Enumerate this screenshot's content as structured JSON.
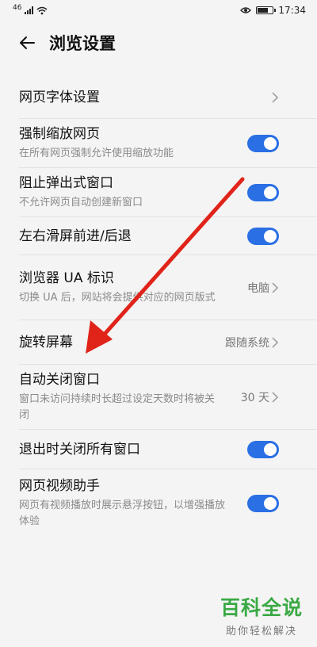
{
  "statusbar": {
    "signal": "46",
    "time": "17:34"
  },
  "header": {
    "title": "浏览设置"
  },
  "settings": [
    {
      "label": "网页字体设置",
      "desc": "",
      "control": "chevron",
      "value": ""
    },
    {
      "label": "强制缩放网页",
      "desc": "在所有网页强制允许使用缩放功能",
      "control": "toggle",
      "on": true
    },
    {
      "label": "阻止弹出式窗口",
      "desc": "不允许网页自动创建新窗口",
      "control": "toggle",
      "on": true
    },
    {
      "label": "左右滑屏前进/后退",
      "desc": "",
      "control": "toggle",
      "on": true
    },
    {
      "label": "浏览器 UA 标识",
      "desc": "切换 UA 后，网站将会提供对应的网页版式",
      "control": "chevron",
      "value": "电脑"
    },
    {
      "label": "旋转屏幕",
      "desc": "",
      "control": "chevron",
      "value": "跟随系统"
    },
    {
      "label": "自动关闭窗口",
      "desc": "窗口未访问持续时长超过设定天数时将被关闭",
      "control": "chevron",
      "value": "30 天"
    },
    {
      "label": "退出时关闭所有窗口",
      "desc": "",
      "control": "toggle",
      "on": true
    },
    {
      "label": "网页视频助手",
      "desc": "网页有视频播放时展示悬浮按钮，以增强播放体验",
      "control": "toggle",
      "on": true
    }
  ],
  "watermark": {
    "title": "百科全说",
    "subtitle": "助你轻松解决"
  },
  "colors": {
    "toggle_on": "#2a6fe4",
    "annotation_arrow": "#e0241a",
    "watermark_green": "#3aa944"
  }
}
